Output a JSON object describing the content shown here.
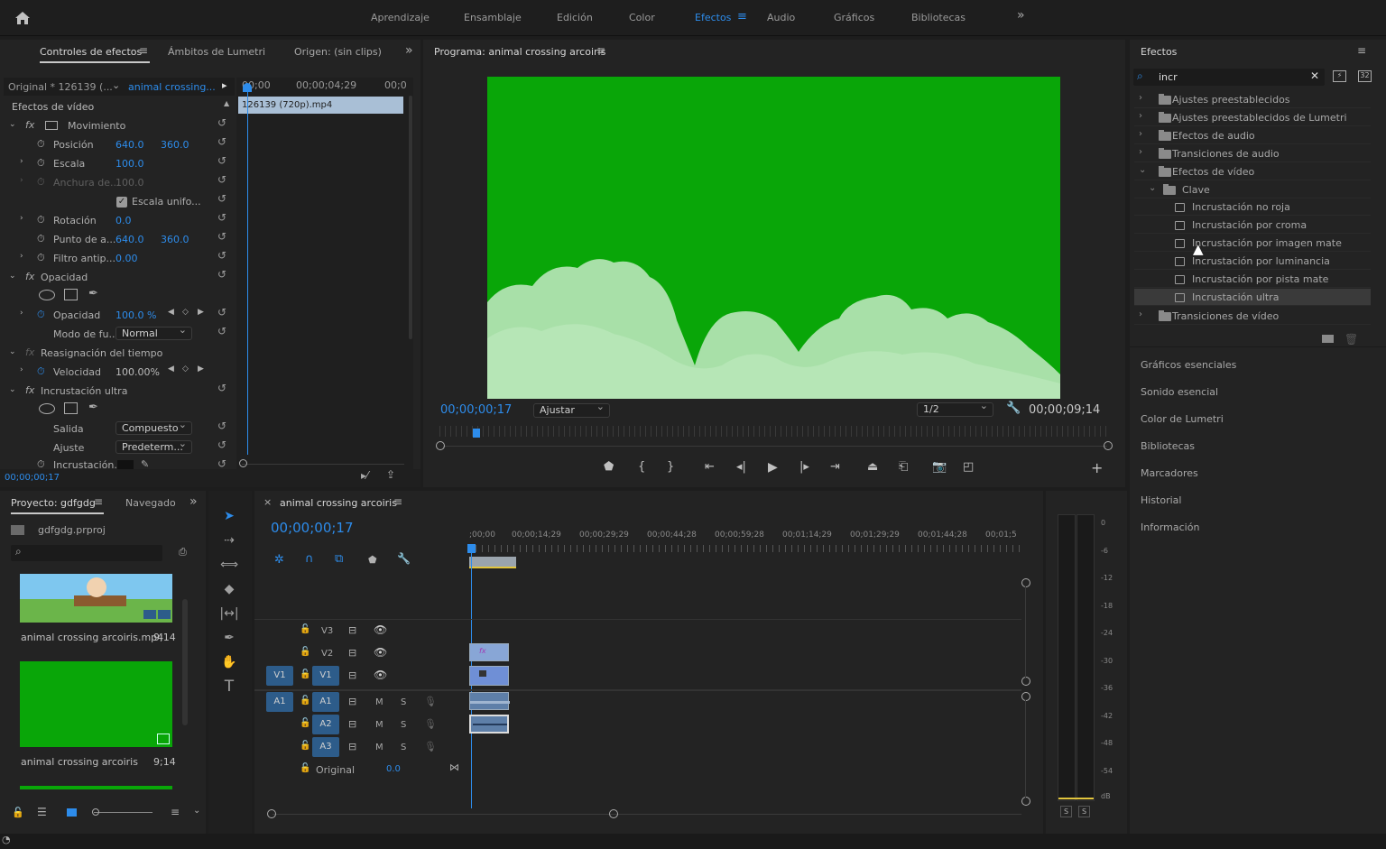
{
  "workspaces": [
    "Aprendizaje",
    "Ensamblaje",
    "Edición",
    "Color",
    "Efectos",
    "Audio",
    "Gráficos",
    "Bibliotecas"
  ],
  "effect_controls": {
    "tabs": [
      "Controles de efectos",
      "Ámbitos de Lumetri",
      "Origen: (sin clips)"
    ],
    "source_label": "Original * 126139 (...",
    "seq_label": "animal crossing...",
    "ruler": [
      "00;00",
      "00;00;04;29",
      "00;0"
    ],
    "clip_name": "126139 (720p).mp4",
    "section": "Efectos de vídeo",
    "motion": "Movimiento",
    "position_label": "Posición",
    "position_x": "640.0",
    "position_y": "360.0",
    "scale_label": "Escala",
    "scale_value": "100.0",
    "width_label": "Anchura de...",
    "width_value": "100.0",
    "uniform_label": "Escala unifo...",
    "rotation_label": "Rotación",
    "rotation_value": "0.0",
    "anchor_label": "Punto de a...",
    "anchor_x": "640.0",
    "anchor_y": "360.0",
    "flicker_label": "Filtro antip...",
    "flicker_value": "0.00",
    "opacity_group": "Opacidad",
    "opacity_label": "Opacidad",
    "opacity_value": "100.0 %",
    "blend_label": "Modo de fu...",
    "blend_value": "Normal",
    "timeremap": "Reasignación del tiempo",
    "speed_label": "Velocidad",
    "speed_value": "100.00%",
    "ultra_key": "Incrustación ultra",
    "output_label": "Salida",
    "output_value": "Compuesto",
    "setting_label": "Ajuste",
    "setting_value": "Predeterm...",
    "keycolor_label": "Incrustación...",
    "timecode": "00;00;00;17"
  },
  "program": {
    "title": "Programa: animal crossing arcoiris",
    "timecode": "00;00;00;17",
    "fit": "Ajustar",
    "resolution": "1/2",
    "duration": "00;00;09;14"
  },
  "effects_panel": {
    "title": "Efectos",
    "search": "incr",
    "items": [
      "Ajustes preestablecidos",
      "Ajustes preestablecidos de Lumetri",
      "Efectos de audio",
      "Transiciones de audio",
      "Efectos de vídeo",
      "Clave",
      "Incrustación no roja",
      "Incrustación por croma",
      "Incrustación por imagen mate",
      "Incrustación por luminancia",
      "Incrustación por pista mate",
      "Incrustación ultra",
      "Transiciones de vídeo"
    ],
    "side_panels": [
      "Gráficos esenciales",
      "Sonido esencial",
      "Color de Lumetri",
      "Bibliotecas",
      "Marcadores",
      "Historial",
      "Información"
    ]
  },
  "project": {
    "tabs": [
      "Proyecto: gdfgdg",
      "Navegado"
    ],
    "file": "gdfgdg.prproj",
    "items": [
      {
        "name": "animal crossing arcoiris.mp4",
        "dur": "9;14"
      },
      {
        "name": "animal crossing arcoiris",
        "dur": "9;14"
      }
    ]
  },
  "timeline": {
    "tab": "animal crossing arcoiris",
    "timecode": "00;00;00;17",
    "ruler": [
      ";00;00",
      "00;00;14;29",
      "00;00;29;29",
      "00;00;44;28",
      "00;00;59;28",
      "00;01;14;29",
      "00;01;29;29",
      "00;01;44;28",
      "00;01;5"
    ],
    "tracks": [
      "V3",
      "V2",
      "V1",
      "A1",
      "A2",
      "A3"
    ],
    "src_v": "V1",
    "src_a": "A1",
    "mix_label": "Original",
    "mix_value": "0.0",
    "m": "M",
    "s": "S"
  },
  "meter": {
    "scale": [
      "0",
      "-6",
      "-12",
      "-18",
      "-24",
      "-30",
      "-36",
      "-42",
      "-48",
      "-54",
      "dB"
    ],
    "solo": [
      "S",
      "S"
    ]
  }
}
